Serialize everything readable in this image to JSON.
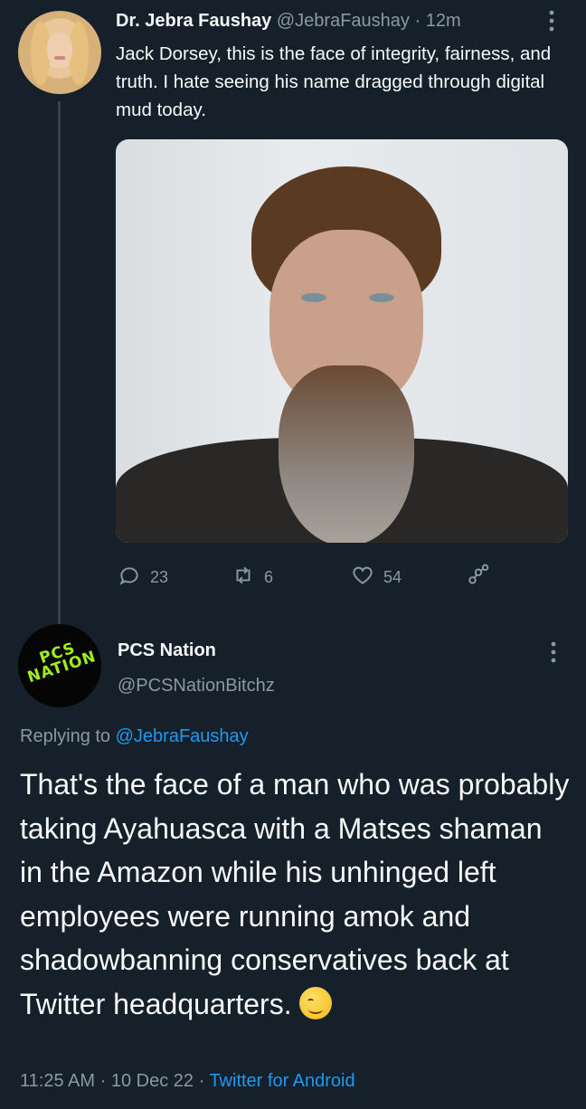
{
  "parent_tweet": {
    "display_name": "Dr. Jebra Faushay",
    "handle": "@JebraFaushay",
    "separator": "·",
    "time_ago": "12m",
    "more_glyph": "⋮",
    "text": "Jack Dorsey, this is the face of integrity, fairness, and truth. I hate seeing his name dragged through digital mud today.",
    "actions": {
      "replies": "23",
      "retweets": "6",
      "likes": "54"
    }
  },
  "reply_tweet": {
    "display_name": "PCS Nation",
    "handle": "@PCSNationBitchz",
    "more_glyph": "⋮",
    "avatar_logo_text": "PCS NATION",
    "replying_prefix": "Replying to",
    "replying_to": "@JebraFaushay",
    "text": "That's the face of a man who was probably taking Ayahuasca with a Matses shaman in the Amazon while his unhinged left employees were running amok and shadowbanning conservatives back at Twitter headquarters.",
    "emoji": "smirking-face",
    "time": "11:25 AM",
    "date": "10 Dec 22",
    "separator": "·",
    "source": "Twitter for Android"
  },
  "colors": {
    "background": "#15202b",
    "primary_text": "#f7f9f9",
    "secondary_text": "#8b98a5",
    "link": "#1d9bf0",
    "thread_line": "#38444d",
    "logo_green": "#9ef01a"
  }
}
